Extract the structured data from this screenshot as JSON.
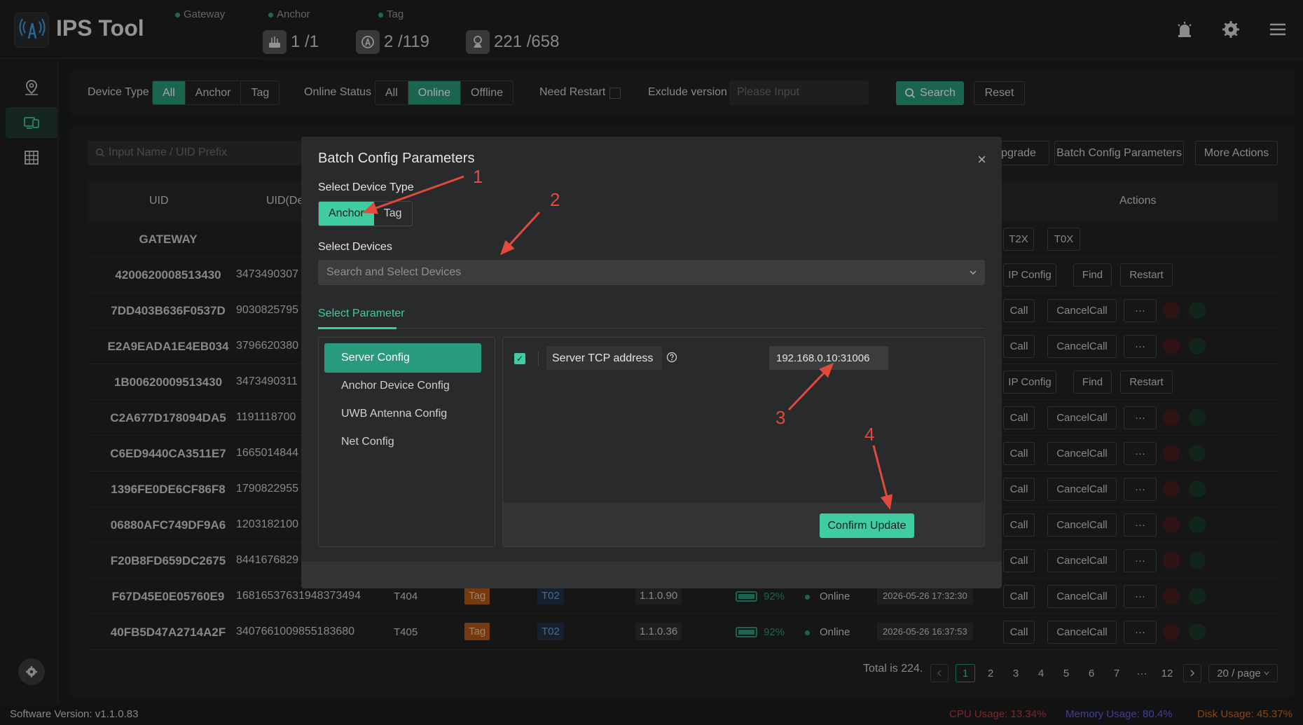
{
  "app": {
    "title": "IPS Tool"
  },
  "stats": {
    "gateway": {
      "label": "Gateway",
      "value": "1 /1"
    },
    "anchor": {
      "label": "Anchor",
      "value": "2 /119"
    },
    "tag": {
      "label": "Tag",
      "value": "221 /658"
    }
  },
  "filters": {
    "device_type_label": "Device Type",
    "device_type_options": [
      "All",
      "Anchor",
      "Tag"
    ],
    "device_type_selected": "All",
    "online_status_label": "Online Status",
    "online_status_options": [
      "All",
      "Online",
      "Offline"
    ],
    "online_status_selected": "Online",
    "need_restart_label": "Need Restart",
    "exclude_version_label": "Exclude version",
    "exclude_version_placeholder": "Please Input",
    "search_label": "Search",
    "reset_label": "Reset"
  },
  "toolbar": {
    "name_placeholder": "Input Name / UID Prefix",
    "upgrade_label": "pgrade",
    "batch_config_label": "Batch Config Parameters",
    "more_actions_label": "More Actions"
  },
  "table": {
    "headers": {
      "uid": "UID",
      "uid_dec": "UID(De",
      "actions": "Actions"
    },
    "gateway_label": "GATEWAY",
    "gateway_actions": [
      "T2X",
      "T0X"
    ],
    "rows": [
      {
        "uid": "4200620008513430",
        "uid_dec": "3473490307",
        "actions": [
          "IP Config",
          "Find",
          "Restart"
        ]
      },
      {
        "uid": "7DD403B636F0537D",
        "uid_dec": "9030825795",
        "actions": [
          "Call",
          "CancelCall",
          "···"
        ]
      },
      {
        "uid": "E2A9EADA1E4EB034",
        "uid_dec": "3796620380",
        "actions": [
          "Call",
          "CancelCall",
          "···"
        ]
      },
      {
        "uid": "1B00620009513430",
        "uid_dec": "3473490311",
        "actions": [
          "IP Config",
          "Find",
          "Restart"
        ]
      },
      {
        "uid": "C2A677D178094DA5",
        "uid_dec": "1191118700",
        "actions": [
          "Call",
          "CancelCall",
          "···"
        ]
      },
      {
        "uid": "C6ED9440CA3511E7",
        "uid_dec": "1665014844",
        "actions": [
          "Call",
          "CancelCall",
          "···"
        ]
      },
      {
        "uid": "1396FE0DE6CF86F8",
        "uid_dec": "1790822955",
        "actions": [
          "Call",
          "CancelCall",
          "···"
        ]
      },
      {
        "uid": "06880AFC749DF9A6",
        "uid_dec": "1203182100",
        "actions": [
          "Call",
          "CancelCall",
          "···"
        ]
      },
      {
        "uid": "F20B8FD659DC2675",
        "uid_dec": "8441676829",
        "actions": [
          "Call",
          "CancelCall",
          "···"
        ]
      },
      {
        "uid": "F67D45E0E05760E9",
        "uid_dec": "16816537631948373494",
        "name": "T404",
        "type": "Tag",
        "model": "T02",
        "version": "1.1.0.90",
        "battery": "92%",
        "battery_level": 0.92,
        "status": "Online",
        "time": "2026-05-26 17:32:30",
        "actions": [
          "Call",
          "CancelCall",
          "···"
        ]
      },
      {
        "uid": "40FB5D47A2714A2F",
        "uid_dec": "3407661009855183680",
        "name": "T405",
        "type": "Tag",
        "model": "T02",
        "version": "1.1.0.36",
        "battery": "92%",
        "battery_level": 0.92,
        "status": "Online",
        "time": "2026-05-26 16:37:53",
        "actions": [
          "Call",
          "CancelCall",
          "···"
        ]
      }
    ]
  },
  "pagination": {
    "total": "Total is 224.",
    "pages": [
      "1",
      "2",
      "3",
      "4",
      "5",
      "6",
      "7",
      "···",
      "12"
    ],
    "current": "1",
    "page_size": "20 / page"
  },
  "footer": {
    "version": "Software Version:  v1.1.0.83",
    "cpu": "CPU Usage:  13.34%",
    "memory": "Memory Usage:  80.4%",
    "disk": "Disk Usage:  45.37%"
  },
  "modal": {
    "title": "Batch Config Parameters",
    "close": "×",
    "device_type_label": "Select Device Type",
    "device_type_options": [
      "Anchor",
      "Tag"
    ],
    "device_type_selected": "Anchor",
    "devices_label": "Select Devices",
    "devices_placeholder": "Search and Select Devices",
    "param_tab": "Select Parameter",
    "categories": [
      "Server Config",
      "Anchor Device Config",
      "UWB Antenna Config",
      "Net Config"
    ],
    "selected_category": "Server Config",
    "param_name": "Server TCP address",
    "param_value": "192.168.0.10:31006",
    "confirm_label": "Confirm Update"
  },
  "annotations": [
    "1",
    "2",
    "3",
    "4"
  ],
  "colors": {
    "accent": "#2a9a7c",
    "accent_light": "#3fcca0",
    "annotation": "#e24a3b",
    "tag_orange": "#b45a18"
  }
}
